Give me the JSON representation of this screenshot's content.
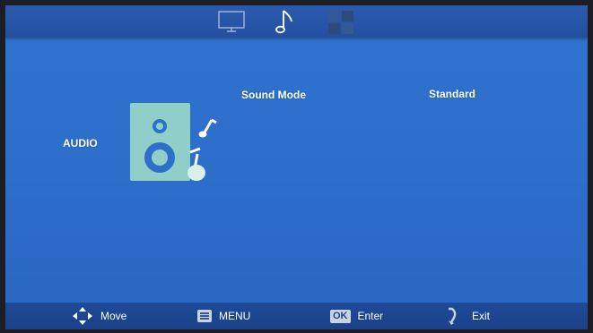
{
  "top_tabs": [
    {
      "name": "picture",
      "icon": "tv-icon",
      "selected": false
    },
    {
      "name": "sound",
      "icon": "music-note-icon",
      "selected": true
    },
    {
      "name": "setup",
      "icon": "grid-icon",
      "selected": false
    }
  ],
  "section": {
    "title": "AUDIO"
  },
  "settings": [
    {
      "label": "Sound Mode",
      "value": "Standard"
    }
  ],
  "bottom_hints": {
    "move": "Move",
    "menu": "MENU",
    "ok_key": "OK",
    "enter": "Enter",
    "exit": "Exit"
  },
  "colors": {
    "background": "#2f73cf",
    "bar": "#244f9f",
    "illustration": "#8fcfc8",
    "text": "#ffffff"
  }
}
